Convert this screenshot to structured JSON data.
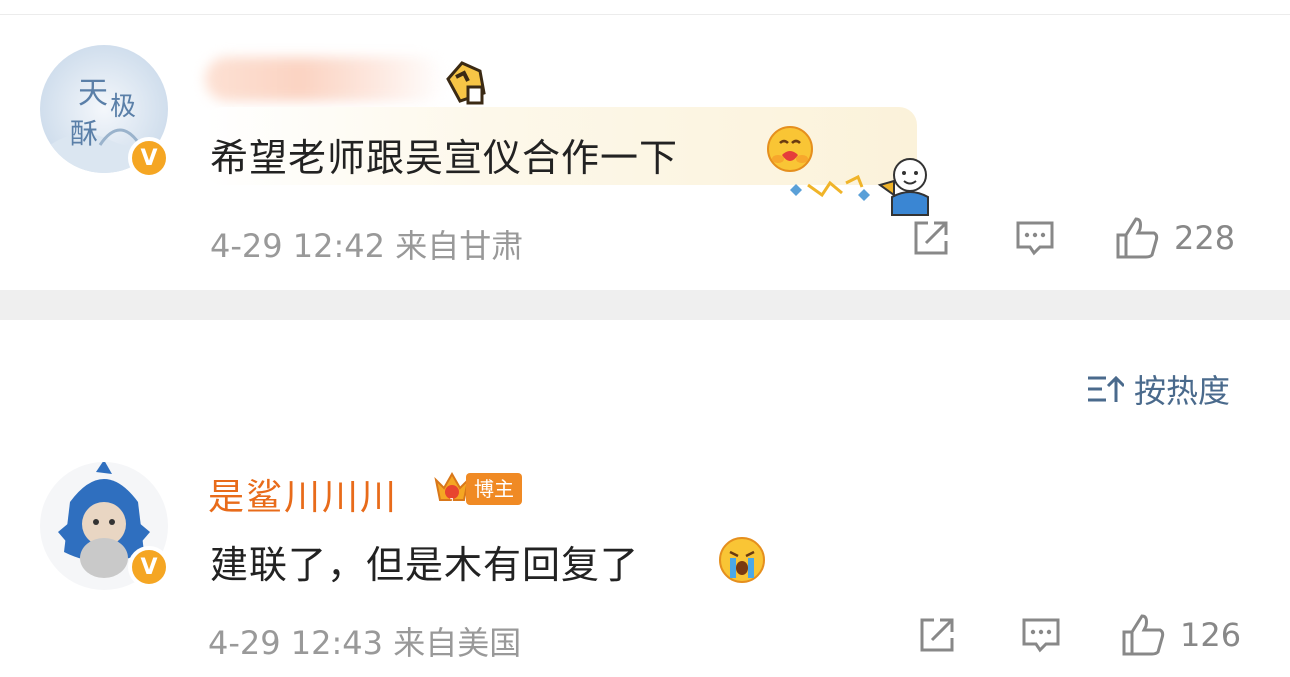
{
  "comments": [
    {
      "username": "",
      "text": "希望老师跟吴宣仪合作一下",
      "emoji": "hug-emoji",
      "timestamp": "4-29 12:42",
      "location": "来自甘肃",
      "likes": "228"
    },
    {
      "username": "是鲨川川川",
      "badge": "博主",
      "text": "建联了，但是木有回复了",
      "emoji": "crying-emoji",
      "timestamp": "4-29 12:43",
      "location": "来自美国",
      "likes": "126"
    }
  ],
  "sort": {
    "label": "按热度"
  },
  "colors": {
    "accent_orange": "#e86b1a",
    "verified": "#f5a623",
    "meta_gray": "#999999",
    "sort_blue": "#4a6a8c"
  }
}
